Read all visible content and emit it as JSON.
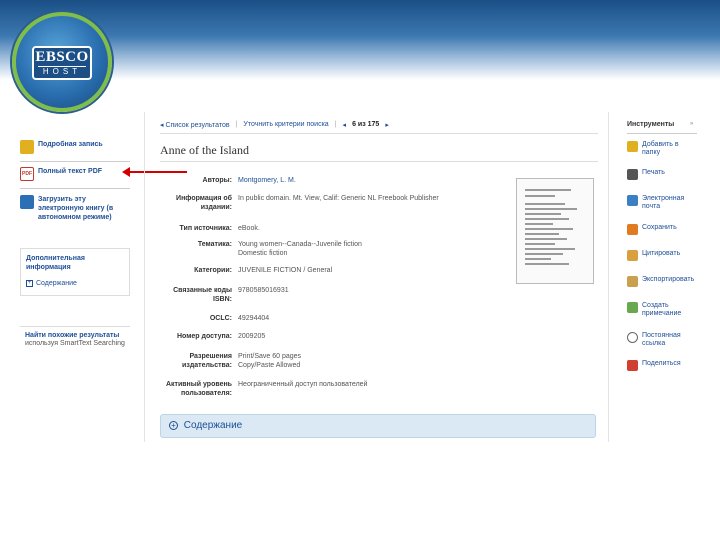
{
  "logo": {
    "top": "EBSCO",
    "bottom": "HOST"
  },
  "left_panel": {
    "items": [
      {
        "label": "Подробная запись",
        "icon": "detail-record-icon",
        "color": "#e0b020"
      },
      {
        "label": "Полный текст PDF",
        "icon": "pdf-icon",
        "color": "#c0392b"
      },
      {
        "label": "Загрузить эту электронную книгу (в автономном режиме)",
        "icon": "download-icon",
        "color": "#2b6fb5"
      }
    ],
    "box1": {
      "title": "Дополнительная информация",
      "link": "Содержание"
    },
    "box2": {
      "title": "Найти похожие результаты",
      "subtitle": "используя SmartText Searching"
    }
  },
  "nav": {
    "back": "◂ Список результатов",
    "refine": "Уточнить критерии поиска",
    "prev": "◂",
    "position": "6 из 175",
    "next": "▸"
  },
  "record": {
    "title": "Anne of the Island",
    "fields": [
      {
        "label": "Авторы:",
        "value": "Montgomery, L. M.",
        "link": true
      },
      {
        "label": "Информация об издании:",
        "value": "In public domain. Mt. View, Calif: Generic NL Freebook Publisher",
        "link": false
      },
      {
        "label": "Тип источника:",
        "value": "eBook.",
        "link": false
      },
      {
        "label": "Тематика:",
        "value": "Young women--Canada--Juvenile fiction\nDomestic fiction",
        "link": true
      },
      {
        "label": "Категории:",
        "value": "JUVENILE FICTION / General",
        "link": true
      },
      {
        "label": "Связанные коды ISBN:",
        "value": "9780585016931",
        "link": false
      },
      {
        "label": "OCLC:",
        "value": "49294404",
        "link": false
      },
      {
        "label": "Номер доступа:",
        "value": "2009205",
        "link": false
      },
      {
        "label": "Разрешения издательства:",
        "value": "Print/Save 60 pages\nCopy/Paste Allowed",
        "link": false
      },
      {
        "label": "Активный уровень пользователя:",
        "value": "Неограниченный доступ пользователей",
        "link": false
      }
    ]
  },
  "contents_bar": {
    "label": "Содержание"
  },
  "tools": {
    "title": "Инструменты",
    "close": "»",
    "items": [
      {
        "label": "Добавить в папку",
        "icon": "folder-icon",
        "color": "#e0b020"
      },
      {
        "label": "Печать",
        "icon": "print-icon",
        "color": "#555555"
      },
      {
        "label": "Электронная почта",
        "icon": "email-icon",
        "color": "#3b7fc4"
      },
      {
        "label": "Сохранить",
        "icon": "save-icon",
        "color": "#e07b20"
      },
      {
        "label": "Цитировать",
        "icon": "cite-icon",
        "color": "#d9a040"
      },
      {
        "label": "Экспортировать",
        "icon": "export-icon",
        "color": "#c9a050"
      },
      {
        "label": "Создать примечание",
        "icon": "note-icon",
        "color": "#6aa84f"
      },
      {
        "label": "Постоянная ссылка",
        "icon": "permalink-icon",
        "color": "#666666"
      },
      {
        "label": "Поделиться",
        "icon": "share-icon",
        "color": "#d04030"
      }
    ]
  }
}
